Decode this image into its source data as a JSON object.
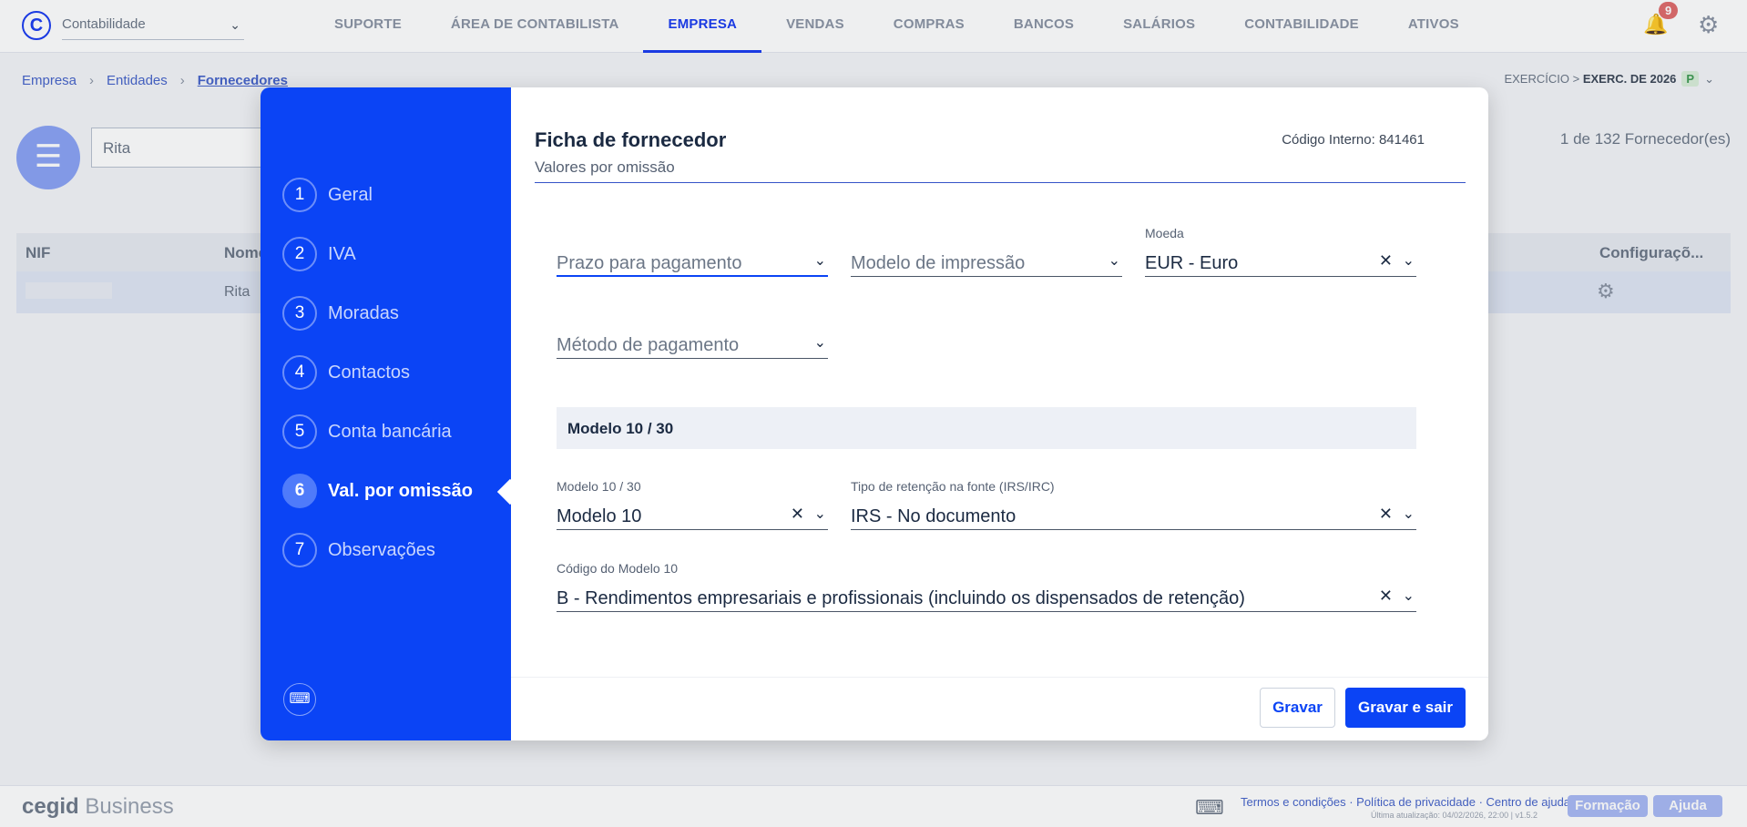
{
  "app": {
    "selector": "Contabilidade"
  },
  "nav": [
    "SUPORTE",
    "ÁREA DE CONTABILISTA",
    "EMPRESA",
    "VENDAS",
    "COMPRAS",
    "BANCOS",
    "SALÁRIOS",
    "CONTABILIDADE",
    "ATIVOS"
  ],
  "notifications": {
    "count": "9"
  },
  "breadcrumb": {
    "items": [
      "Empresa",
      "Entidades",
      "Fornecedores"
    ]
  },
  "exercicio": {
    "prefix": "EXERCÍCIO >",
    "value": "EXERC. DE 2026",
    "badge": "P"
  },
  "list": {
    "search_value": "Rita",
    "count": "1 de 132 Fornecedor(es)",
    "columns": {
      "nif": "NIF",
      "nome": "Nome",
      "config": "Configuraçõ..."
    },
    "row": {
      "nome": "Rita"
    }
  },
  "modal": {
    "title": "Ficha de fornecedor",
    "subtitle": "Valores por omissão",
    "internal_code": "Código Interno: 841461",
    "steps": [
      {
        "num": "1",
        "label": "Geral"
      },
      {
        "num": "2",
        "label": "IVA"
      },
      {
        "num": "3",
        "label": "Moradas"
      },
      {
        "num": "4",
        "label": "Contactos"
      },
      {
        "num": "5",
        "label": "Conta bancária"
      },
      {
        "num": "6",
        "label": "Val. por omissão"
      },
      {
        "num": "7",
        "label": "Observações"
      }
    ],
    "fields": {
      "prazo": {
        "placeholder": "Prazo para pagamento"
      },
      "modelo_impressao": {
        "placeholder": "Modelo de impressão"
      },
      "moeda": {
        "label": "Moeda",
        "value": "EUR - Euro"
      },
      "metodo": {
        "placeholder": "Método de pagamento"
      },
      "section": "Modelo 10 / 30",
      "modelo1030": {
        "label": "Modelo 10 / 30",
        "value": "Modelo 10"
      },
      "retencao": {
        "label": "Tipo de retenção na fonte (IRS/IRC)",
        "value": "IRS - No documento"
      },
      "codigo_modelo10": {
        "label": "Código do Modelo 10",
        "value": "B - Rendimentos empresariais e profissionais (incluindo os dispensados de retenção)"
      }
    },
    "buttons": {
      "save": "Gravar",
      "save_exit": "Gravar e sair"
    }
  },
  "footer": {
    "brand_a": "cegid",
    "brand_b": " Business",
    "links": "Termos e condições · Política de privacidade · Centro de ajuda",
    "updated": "Última atualização: 04/02/2026, 22:00 | v1.5.2",
    "btn_formacao": "Formação",
    "btn_ajuda": "Ajuda"
  }
}
